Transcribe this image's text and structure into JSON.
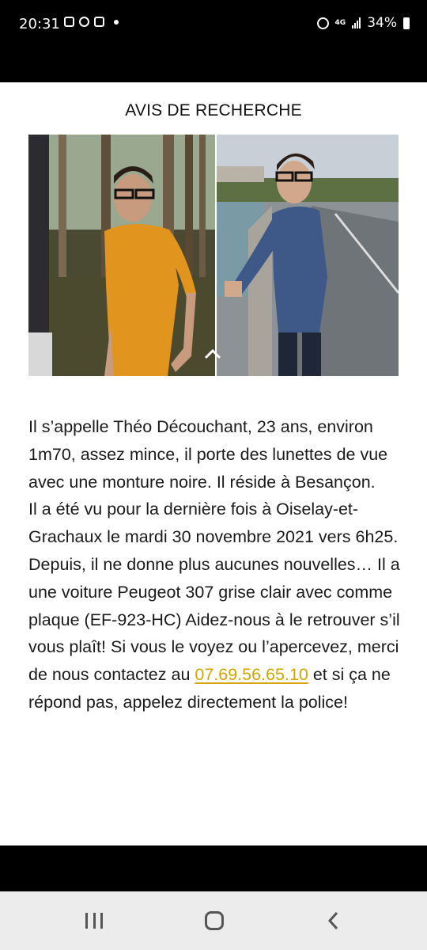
{
  "status_bar": {
    "time": "20:31",
    "network": "4G",
    "battery": "34%",
    "left_icons": [
      "image-icon",
      "messenger-icon",
      "emoji-icon",
      "dot-icon"
    ],
    "right_icons": [
      "alarm-icon",
      "signal-icon",
      "battery-icon"
    ]
  },
  "post": {
    "title": "AVIS DE RECHERCHE",
    "paragraph_1": "Il s’appelle Théo Découchant, 23 ans, environ 1m70, assez mince, il porte des lunettes de vue avec une monture noire. Il réside à Besançon.",
    "paragraph_2": "Il a été vu pour la dernière fois à Oiselay-et-Grachaux le mardi 30 novembre 2021 vers 6h25.",
    "paragraph_3_before": "Depuis, il ne donne plus aucunes nouvelles… Il a une voiture Peugeot 307 grise clair avec comme plaque (EF-923-HC) Aidez-nous à le retrouver s’il vous plaît! Si vous le voyez ou l’apercevez, merci de nous contactez au",
    "phone": "07.69.56.65.10",
    "paragraph_3_after": "et si ça ne répond pas, appelez directement la police!",
    "accent_color": "#d6a400"
  },
  "nav_bar": {
    "icons": [
      "recent-apps-icon",
      "home-icon",
      "back-icon"
    ]
  }
}
